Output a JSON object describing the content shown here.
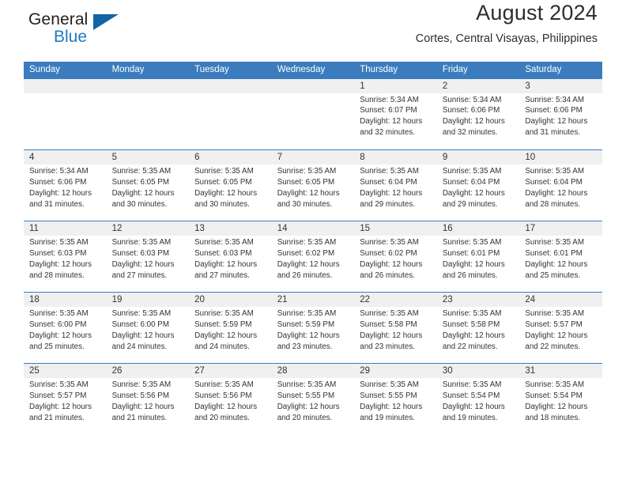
{
  "brand": {
    "name_part1": "General",
    "name_part2": "Blue",
    "triangle_color": "#1464a5",
    "accent_color": "#1f7bc1"
  },
  "header": {
    "month_title": "August 2024",
    "location": "Cortes, Central Visayas, Philippines",
    "header_bg_color": "#3a7cbe",
    "daynum_bg_color": "#f0f0f0"
  },
  "weekday_headers": [
    "Sunday",
    "Monday",
    "Tuesday",
    "Wednesday",
    "Thursday",
    "Friday",
    "Saturday"
  ],
  "weeks": [
    [
      {
        "day": "",
        "blank": true,
        "sunrise": "",
        "sunset": "",
        "daylight1": "",
        "daylight2": ""
      },
      {
        "day": "",
        "blank": true,
        "sunrise": "",
        "sunset": "",
        "daylight1": "",
        "daylight2": ""
      },
      {
        "day": "",
        "blank": true,
        "sunrise": "",
        "sunset": "",
        "daylight1": "",
        "daylight2": ""
      },
      {
        "day": "",
        "blank": true,
        "sunrise": "",
        "sunset": "",
        "daylight1": "",
        "daylight2": ""
      },
      {
        "day": "1",
        "sunrise": "Sunrise: 5:34 AM",
        "sunset": "Sunset: 6:07 PM",
        "daylight1": "Daylight: 12 hours",
        "daylight2": "and 32 minutes."
      },
      {
        "day": "2",
        "sunrise": "Sunrise: 5:34 AM",
        "sunset": "Sunset: 6:06 PM",
        "daylight1": "Daylight: 12 hours",
        "daylight2": "and 32 minutes."
      },
      {
        "day": "3",
        "sunrise": "Sunrise: 5:34 AM",
        "sunset": "Sunset: 6:06 PM",
        "daylight1": "Daylight: 12 hours",
        "daylight2": "and 31 minutes."
      }
    ],
    [
      {
        "day": "4",
        "sunrise": "Sunrise: 5:34 AM",
        "sunset": "Sunset: 6:06 PM",
        "daylight1": "Daylight: 12 hours",
        "daylight2": "and 31 minutes."
      },
      {
        "day": "5",
        "sunrise": "Sunrise: 5:35 AM",
        "sunset": "Sunset: 6:05 PM",
        "daylight1": "Daylight: 12 hours",
        "daylight2": "and 30 minutes."
      },
      {
        "day": "6",
        "sunrise": "Sunrise: 5:35 AM",
        "sunset": "Sunset: 6:05 PM",
        "daylight1": "Daylight: 12 hours",
        "daylight2": "and 30 minutes."
      },
      {
        "day": "7",
        "sunrise": "Sunrise: 5:35 AM",
        "sunset": "Sunset: 6:05 PM",
        "daylight1": "Daylight: 12 hours",
        "daylight2": "and 30 minutes."
      },
      {
        "day": "8",
        "sunrise": "Sunrise: 5:35 AM",
        "sunset": "Sunset: 6:04 PM",
        "daylight1": "Daylight: 12 hours",
        "daylight2": "and 29 minutes."
      },
      {
        "day": "9",
        "sunrise": "Sunrise: 5:35 AM",
        "sunset": "Sunset: 6:04 PM",
        "daylight1": "Daylight: 12 hours",
        "daylight2": "and 29 minutes."
      },
      {
        "day": "10",
        "sunrise": "Sunrise: 5:35 AM",
        "sunset": "Sunset: 6:04 PM",
        "daylight1": "Daylight: 12 hours",
        "daylight2": "and 28 minutes."
      }
    ],
    [
      {
        "day": "11",
        "sunrise": "Sunrise: 5:35 AM",
        "sunset": "Sunset: 6:03 PM",
        "daylight1": "Daylight: 12 hours",
        "daylight2": "and 28 minutes."
      },
      {
        "day": "12",
        "sunrise": "Sunrise: 5:35 AM",
        "sunset": "Sunset: 6:03 PM",
        "daylight1": "Daylight: 12 hours",
        "daylight2": "and 27 minutes."
      },
      {
        "day": "13",
        "sunrise": "Sunrise: 5:35 AM",
        "sunset": "Sunset: 6:03 PM",
        "daylight1": "Daylight: 12 hours",
        "daylight2": "and 27 minutes."
      },
      {
        "day": "14",
        "sunrise": "Sunrise: 5:35 AM",
        "sunset": "Sunset: 6:02 PM",
        "daylight1": "Daylight: 12 hours",
        "daylight2": "and 26 minutes."
      },
      {
        "day": "15",
        "sunrise": "Sunrise: 5:35 AM",
        "sunset": "Sunset: 6:02 PM",
        "daylight1": "Daylight: 12 hours",
        "daylight2": "and 26 minutes."
      },
      {
        "day": "16",
        "sunrise": "Sunrise: 5:35 AM",
        "sunset": "Sunset: 6:01 PM",
        "daylight1": "Daylight: 12 hours",
        "daylight2": "and 26 minutes."
      },
      {
        "day": "17",
        "sunrise": "Sunrise: 5:35 AM",
        "sunset": "Sunset: 6:01 PM",
        "daylight1": "Daylight: 12 hours",
        "daylight2": "and 25 minutes."
      }
    ],
    [
      {
        "day": "18",
        "sunrise": "Sunrise: 5:35 AM",
        "sunset": "Sunset: 6:00 PM",
        "daylight1": "Daylight: 12 hours",
        "daylight2": "and 25 minutes."
      },
      {
        "day": "19",
        "sunrise": "Sunrise: 5:35 AM",
        "sunset": "Sunset: 6:00 PM",
        "daylight1": "Daylight: 12 hours",
        "daylight2": "and 24 minutes."
      },
      {
        "day": "20",
        "sunrise": "Sunrise: 5:35 AM",
        "sunset": "Sunset: 5:59 PM",
        "daylight1": "Daylight: 12 hours",
        "daylight2": "and 24 minutes."
      },
      {
        "day": "21",
        "sunrise": "Sunrise: 5:35 AM",
        "sunset": "Sunset: 5:59 PM",
        "daylight1": "Daylight: 12 hours",
        "daylight2": "and 23 minutes."
      },
      {
        "day": "22",
        "sunrise": "Sunrise: 5:35 AM",
        "sunset": "Sunset: 5:58 PM",
        "daylight1": "Daylight: 12 hours",
        "daylight2": "and 23 minutes."
      },
      {
        "day": "23",
        "sunrise": "Sunrise: 5:35 AM",
        "sunset": "Sunset: 5:58 PM",
        "daylight1": "Daylight: 12 hours",
        "daylight2": "and 22 minutes."
      },
      {
        "day": "24",
        "sunrise": "Sunrise: 5:35 AM",
        "sunset": "Sunset: 5:57 PM",
        "daylight1": "Daylight: 12 hours",
        "daylight2": "and 22 minutes."
      }
    ],
    [
      {
        "day": "25",
        "sunrise": "Sunrise: 5:35 AM",
        "sunset": "Sunset: 5:57 PM",
        "daylight1": "Daylight: 12 hours",
        "daylight2": "and 21 minutes."
      },
      {
        "day": "26",
        "sunrise": "Sunrise: 5:35 AM",
        "sunset": "Sunset: 5:56 PM",
        "daylight1": "Daylight: 12 hours",
        "daylight2": "and 21 minutes."
      },
      {
        "day": "27",
        "sunrise": "Sunrise: 5:35 AM",
        "sunset": "Sunset: 5:56 PM",
        "daylight1": "Daylight: 12 hours",
        "daylight2": "and 20 minutes."
      },
      {
        "day": "28",
        "sunrise": "Sunrise: 5:35 AM",
        "sunset": "Sunset: 5:55 PM",
        "daylight1": "Daylight: 12 hours",
        "daylight2": "and 20 minutes."
      },
      {
        "day": "29",
        "sunrise": "Sunrise: 5:35 AM",
        "sunset": "Sunset: 5:55 PM",
        "daylight1": "Daylight: 12 hours",
        "daylight2": "and 19 minutes."
      },
      {
        "day": "30",
        "sunrise": "Sunrise: 5:35 AM",
        "sunset": "Sunset: 5:54 PM",
        "daylight1": "Daylight: 12 hours",
        "daylight2": "and 19 minutes."
      },
      {
        "day": "31",
        "sunrise": "Sunrise: 5:35 AM",
        "sunset": "Sunset: 5:54 PM",
        "daylight1": "Daylight: 12 hours",
        "daylight2": "and 18 minutes."
      }
    ]
  ]
}
